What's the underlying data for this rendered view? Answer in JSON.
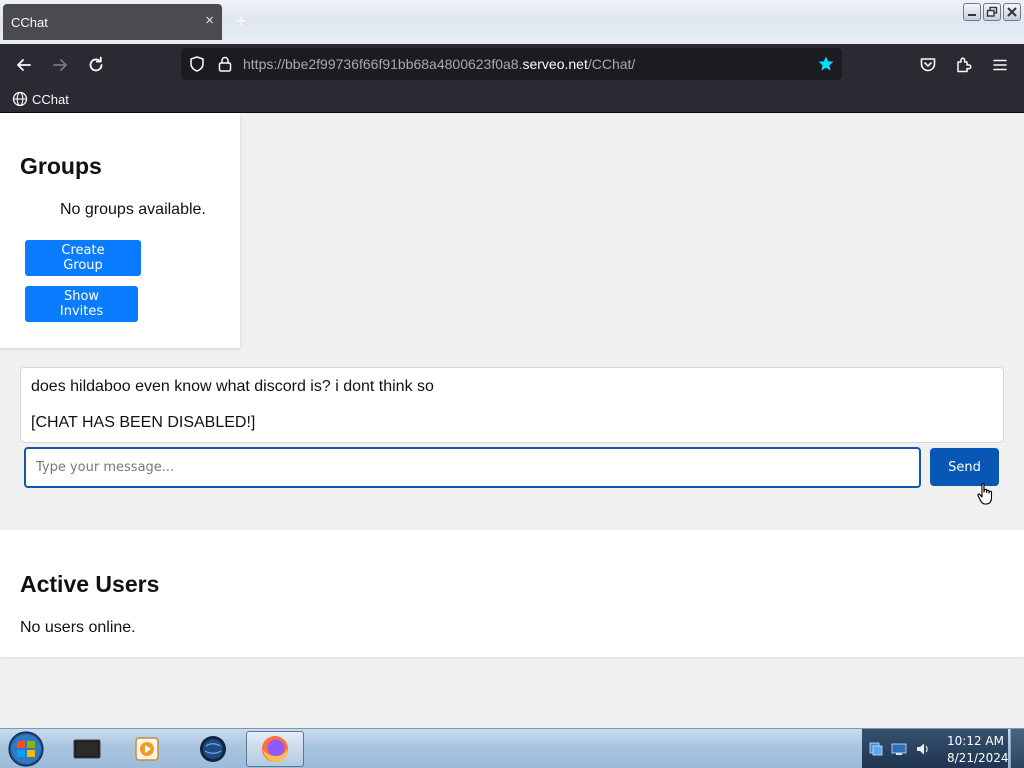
{
  "browser": {
    "tab_title": "CChat",
    "tab_close": "×",
    "new_tab": "+",
    "url_prefix": "https://bbe2f99736f66f91bb68a4800623f0a8.",
    "url_host": "serveo.net",
    "url_path": "/CChat/",
    "bookmark_label": "CChat",
    "accent_star_color": "#00ddff"
  },
  "groups": {
    "title": "Groups",
    "empty_text": "No groups available.",
    "create_label": "Create Group",
    "invites_label": "Show Invites"
  },
  "chat": {
    "messages": [
      "does hildaboo even know what discord is? i dont think so",
      "[CHAT HAS BEEN DISABLED!]"
    ],
    "input_placeholder": "Type your message...",
    "send_label": "Send"
  },
  "users": {
    "title": "Active Users",
    "empty_text": "No users online."
  },
  "taskbar": {
    "time": "10:12 AM",
    "date": "8/21/2024"
  },
  "colors": {
    "primary_button": "#0a7cff",
    "send_button": "#0857b5",
    "input_border": "#1257a8"
  }
}
